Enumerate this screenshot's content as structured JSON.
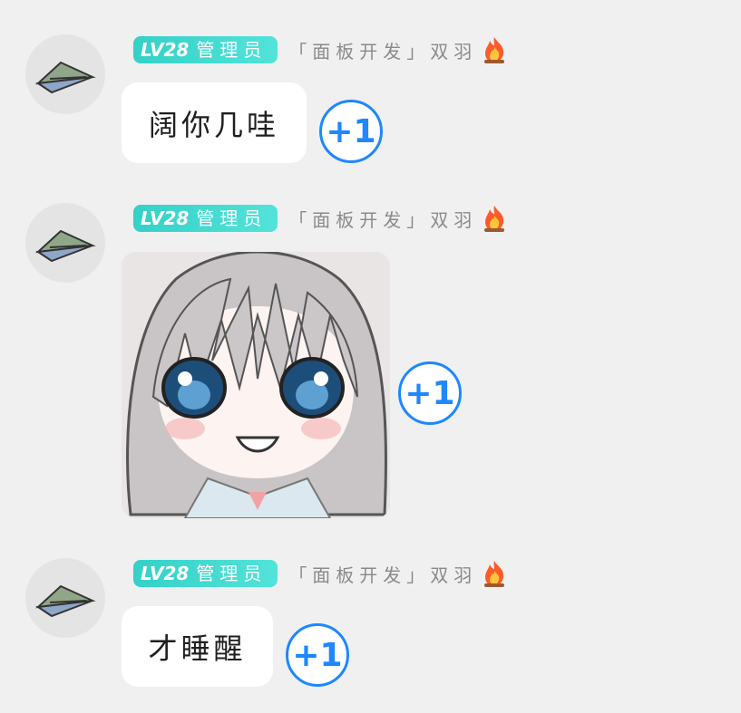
{
  "messages": [
    {
      "badge_level": "LV28",
      "badge_role": "管理员",
      "title": "「面板开发」双羽",
      "text": "阔你几哇",
      "plus_label": "+1"
    },
    {
      "badge_level": "LV28",
      "badge_role": "管理员",
      "title": "「面板开发」双羽",
      "plus_label": "+1"
    },
    {
      "badge_level": "LV28",
      "badge_role": "管理员",
      "title": "「面板开发」双羽",
      "text": "才睡醒",
      "plus_label": "+1"
    }
  ],
  "colors": {
    "badge": "#34d1c7",
    "plus": "#1f87ff",
    "bubble": "#ffffff",
    "background": "#f0f0f0"
  },
  "icons": {
    "avatar": "paper-plane-icon",
    "title_suffix": "fire-icon"
  }
}
